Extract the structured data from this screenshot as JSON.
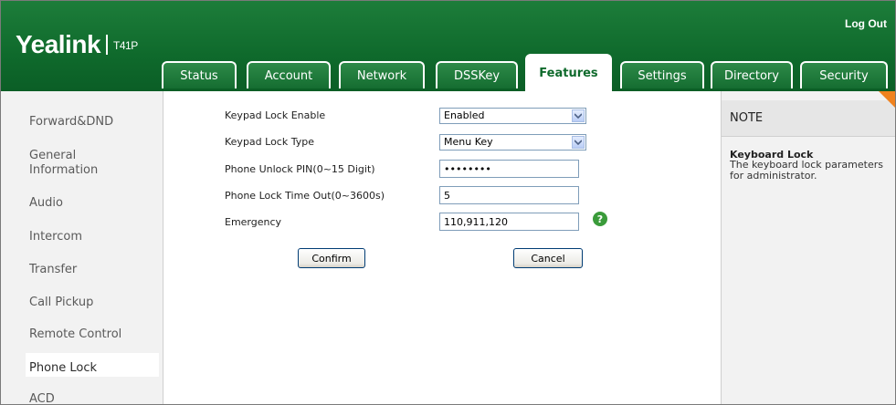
{
  "header": {
    "brand": "Yealink",
    "model": "T41P",
    "logout_label": "Log Out"
  },
  "tabs": [
    {
      "label": "Status"
    },
    {
      "label": "Account"
    },
    {
      "label": "Network"
    },
    {
      "label": "DSSKey"
    },
    {
      "label": "Features",
      "active": true
    },
    {
      "label": "Settings"
    },
    {
      "label": "Directory"
    },
    {
      "label": "Security"
    }
  ],
  "sidebar": {
    "items": [
      {
        "label": "Forward&DND"
      },
      {
        "label": "General Information"
      },
      {
        "label": "Audio"
      },
      {
        "label": "Intercom"
      },
      {
        "label": "Transfer"
      },
      {
        "label": "Call Pickup"
      },
      {
        "label": "Remote Control"
      },
      {
        "label": "Phone Lock",
        "active": true
      },
      {
        "label": "ACD"
      }
    ]
  },
  "form": {
    "keypad_lock_enable": {
      "label": "Keypad Lock Enable",
      "value": "Enabled"
    },
    "keypad_lock_type": {
      "label": "Keypad Lock Type",
      "value": "Menu Key"
    },
    "unlock_pin": {
      "label": "Phone Unlock PIN(0~15 Digit)",
      "value": "••••••••"
    },
    "lock_timeout": {
      "label": "Phone Lock Time Out(0~3600s)",
      "value": "5"
    },
    "emergency": {
      "label": "Emergency",
      "value": "110,911,120"
    },
    "confirm_label": "Confirm",
    "cancel_label": "Cancel"
  },
  "note": {
    "title": "NOTE",
    "heading": "Keyboard Lock",
    "body": "The keyboard lock parameters for administrator."
  },
  "icons": {
    "help": "question-mark-icon",
    "dropdown": "chevron-down-icon",
    "corner": "orange-corner-tab"
  },
  "colors": {
    "header_green": "#0f6a2c",
    "help_green": "#3a9b3a",
    "note_corner": "#f0821e"
  }
}
